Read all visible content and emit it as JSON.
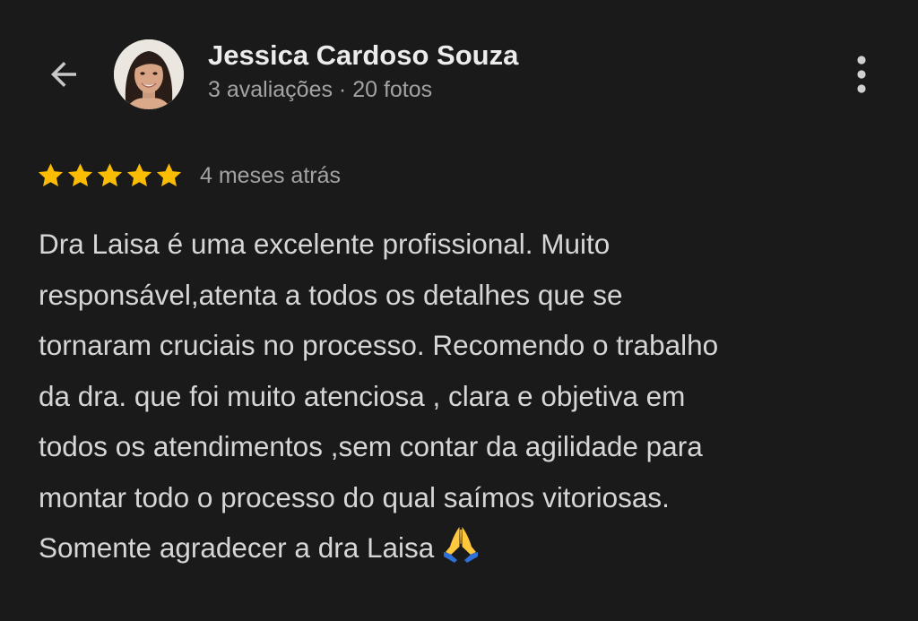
{
  "header": {
    "back_icon": "arrow-left-icon",
    "avatar_icon": "user-avatar",
    "user_name": "Jessica Cardoso Souza",
    "user_meta": "3 avaliações · 20 fotos",
    "menu_icon": "more-vert-icon"
  },
  "review": {
    "rating": 5,
    "rating_max": 5,
    "star_color": "#fbbc04",
    "date": "4 meses atrás",
    "lines": [
      "Dra Laisa é uma excelente profissional. Muito",
      "responsável,atenta a todos os detalhes que se",
      "tornaram cruciais no processo. Recomendo o trabalho",
      "da dra. que foi muito atenciosa , clara e objetiva em",
      "todos os atendimentos ,sem contar da agilidade para",
      "montar todo o processo do qual saímos vitoriosas.",
      "Somente agradecer a dra Laisa"
    ],
    "emoji_icon": "folded-hands-emoji"
  },
  "colors": {
    "background": "#1a1a1a",
    "primary_text": "#ececec",
    "body_text": "#d6d6d6",
    "secondary_text": "#a3a3a3",
    "star": "#fbbc04"
  }
}
